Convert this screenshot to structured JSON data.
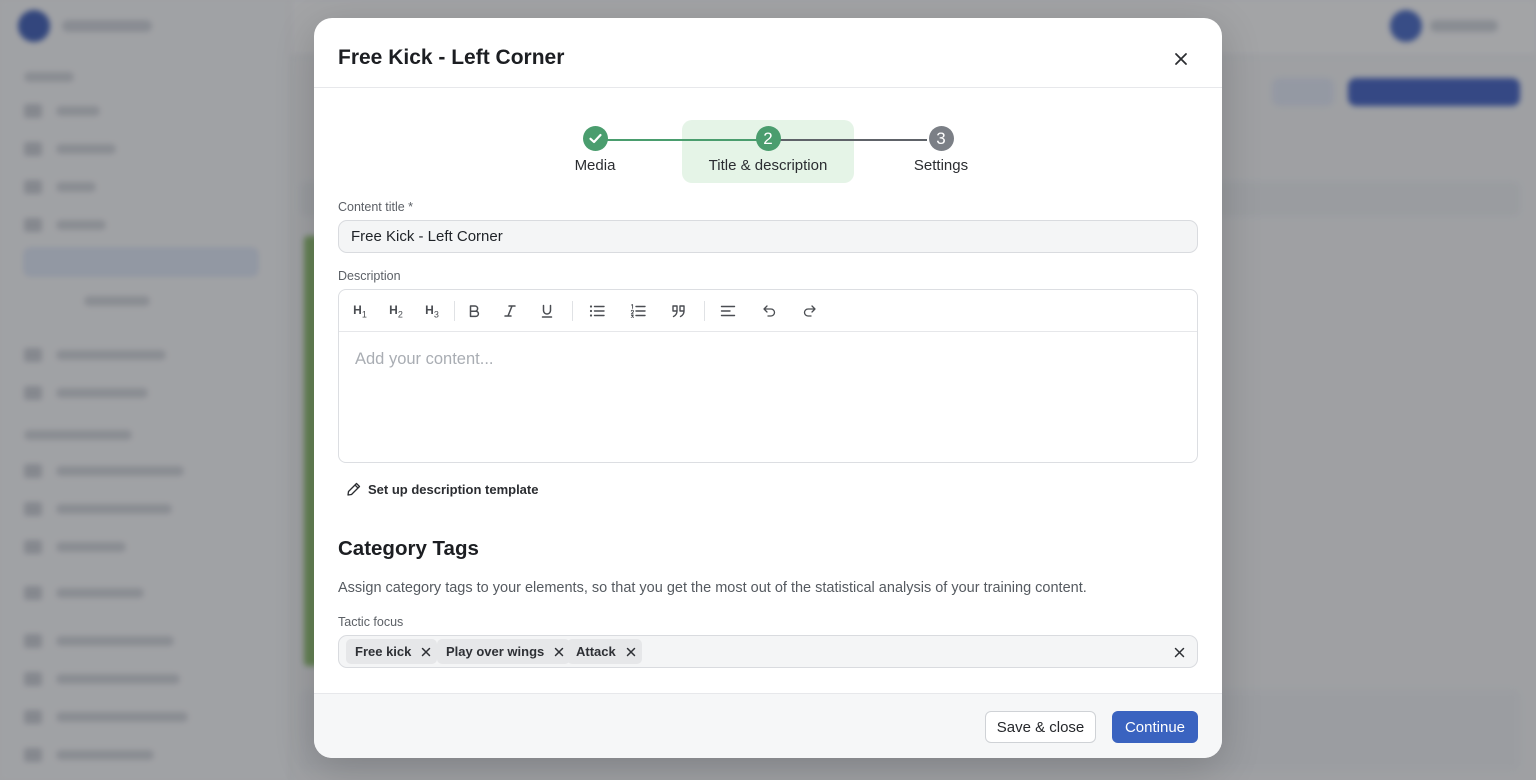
{
  "modal": {
    "title": "Free Kick - Left Corner",
    "close_icon": "close-icon"
  },
  "stepper": {
    "steps": [
      {
        "label": "Media",
        "status": "done",
        "marker": "check-icon"
      },
      {
        "label": "Title & description",
        "status": "current",
        "marker": "2"
      },
      {
        "label": "Settings",
        "status": "upcoming",
        "marker": "3"
      }
    ]
  },
  "form": {
    "title_label": "Content title *",
    "title_value": "Free Kick - Left Corner",
    "description_label": "Description",
    "description_placeholder": "Add your content...",
    "template_link": "Set up description template"
  },
  "toolbar": {
    "h1": "H",
    "h1_sub": "1",
    "h2": "H",
    "h2_sub": "2",
    "h3": "H",
    "h3_sub": "3"
  },
  "category": {
    "title": "Category Tags",
    "description": "Assign category tags to your elements, so that you get the most out of the statistical analysis of your training content.",
    "tactic_label": "Tactic focus",
    "tags": [
      "Free kick",
      "Play over wings",
      "Attack"
    ]
  },
  "footer": {
    "save_close": "Save & close",
    "continue": "Continue"
  },
  "colors": {
    "accent": "#3a63c0",
    "step_done": "#4a9d6e",
    "step_upcoming": "#7b7f86",
    "step_highlight": "#e5f4e7"
  }
}
